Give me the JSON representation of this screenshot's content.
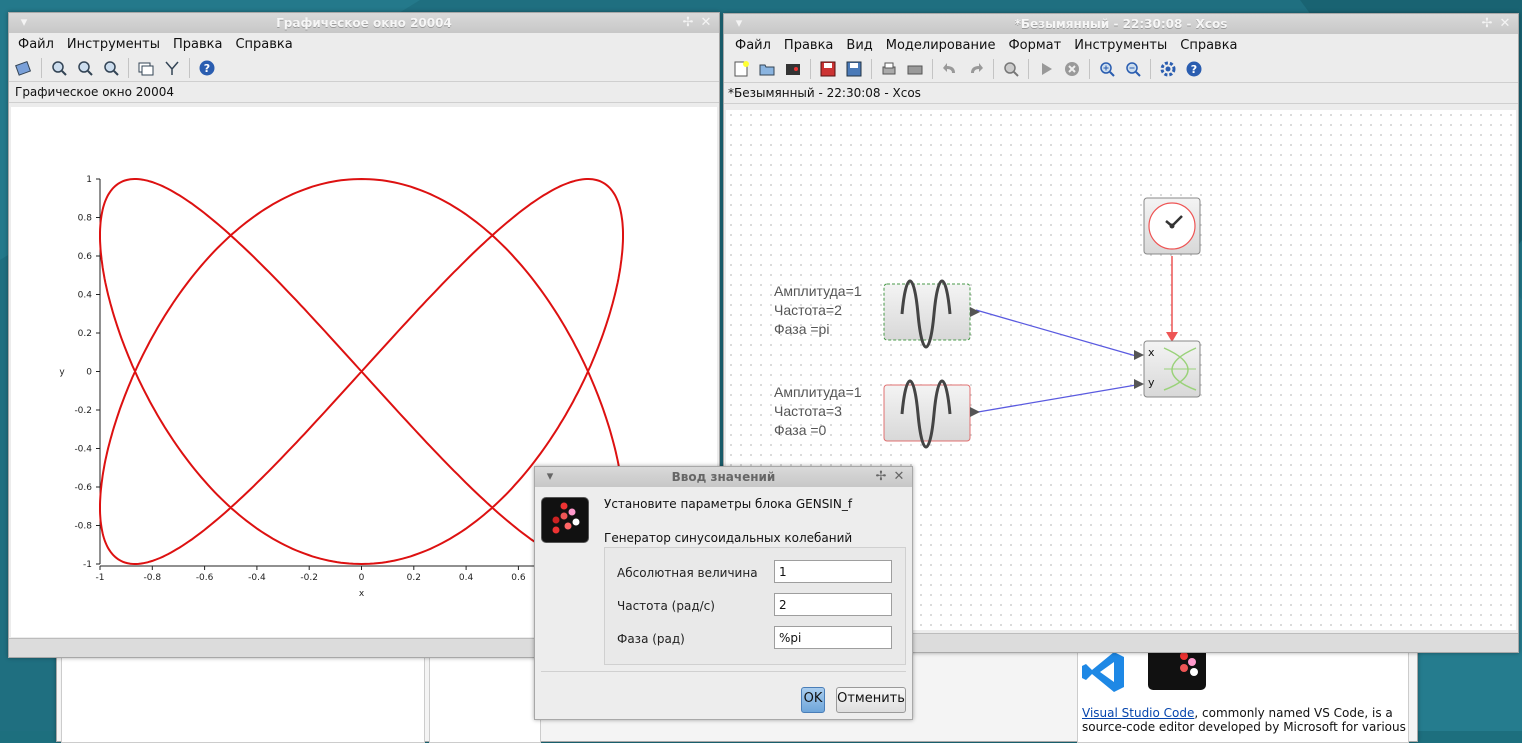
{
  "colors": {
    "curve": "#dd1111",
    "link": "#5050d8",
    "clock_link": "#ee4444",
    "desktop": "#1d6f7e",
    "ok_blue": "#7ab0e0"
  },
  "graphic_window": {
    "title": "Графическое окно 20004",
    "menu": [
      "Файл",
      "Инструменты",
      "Правка",
      "Справка"
    ],
    "subtitle": "Графическое окно 20004",
    "toolbar_icons": [
      "rotate-icon",
      "zoom-in-icon",
      "zoom-fit-icon",
      "zoom-out-icon",
      "datatip-icon",
      "axes-icon",
      "help-icon"
    ],
    "plot": {
      "xlabel": "x",
      "ylabel": "y",
      "xticks": [
        "-1",
        "-0.8",
        "-0.6",
        "-0.4",
        "-0.2",
        "0",
        "0.2",
        "0.4",
        "0.6"
      ],
      "yticks": [
        "1",
        "0.8",
        "0.6",
        "0.4",
        "0.2",
        "0",
        "-0.2",
        "-0.4",
        "-0.6",
        "-0.8",
        "-1"
      ]
    }
  },
  "chart_data": {
    "type": "line",
    "title": "",
    "xlabel": "x",
    "ylabel": "y",
    "xlim": [
      -1,
      1
    ],
    "ylim": [
      -1,
      1
    ],
    "series": [
      {
        "parametric": "x = sin(2t + pi), y = sin(3t)",
        "t_range": [
          0,
          6.2832
        ]
      }
    ],
    "xticks": [
      -1,
      -0.8,
      -0.6,
      -0.4,
      -0.2,
      0,
      0.2,
      0.4,
      0.6
    ],
    "yticks": [
      1,
      0.8,
      0.6,
      0.4,
      0.2,
      0,
      -0.2,
      -0.4,
      -0.6,
      -0.8,
      -1
    ]
  },
  "xcos_window": {
    "title": "*Безымянный - 22:30:08 - Xcos",
    "menu": [
      "Файл",
      "Правка",
      "Вид",
      "Моделирование",
      "Формат",
      "Инструменты",
      "Справка"
    ],
    "subtitle": "*Безымянный - 22:30:08 - Xcos",
    "toolbar_icons": [
      "new-icon",
      "open-icon",
      "open-in-scilab-icon",
      "save-icon",
      "save-as-icon",
      "print-icon",
      "print-preview-icon",
      "undo-icon",
      "redo-icon",
      "zoom-fit-icon",
      "start-icon",
      "stop-icon",
      "zoom-in-icon",
      "zoom-out-icon",
      "setup-icon",
      "help-icon"
    ],
    "block1_label": [
      "Амплитуда=1",
      "Частота=2",
      "Фаза =pi"
    ],
    "block2_label": [
      "Амплитуда=1",
      "Частота=3",
      "Фаза =0"
    ],
    "scope_ports": [
      "x",
      "y"
    ]
  },
  "dialog": {
    "title": "Ввод значений",
    "heading": "Установите параметры блока GENSIN_f",
    "description": "Генератор синусоидальных колебаний",
    "fields": [
      {
        "label": "Абсолютная величина",
        "value": "1"
      },
      {
        "label": "Частота (рад/с)",
        "value": "2"
      },
      {
        "label": "Фаза (рад)",
        "value": "%pi"
      }
    ],
    "ok": "OK",
    "cancel": "Отменить"
  },
  "background_browser": {
    "link": "Visual Studio Code",
    "text1": ", commonly named VS Code, is a",
    "text2": "source-code editor developed by Microsoft for various"
  }
}
